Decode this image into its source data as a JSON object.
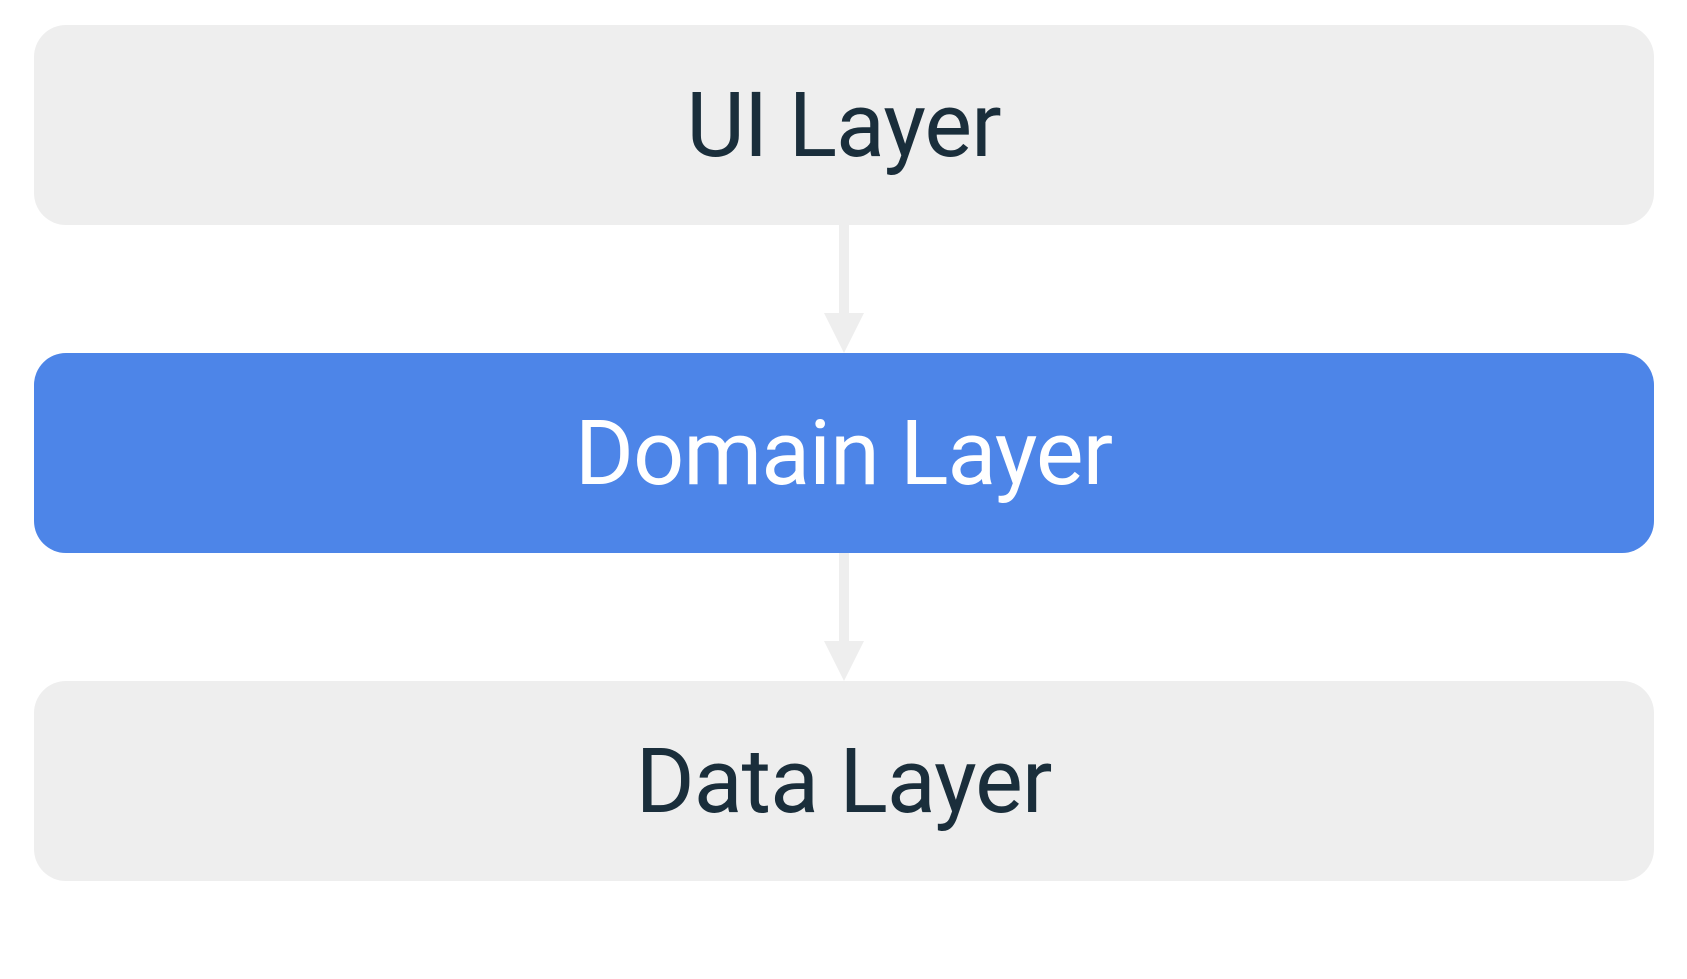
{
  "diagram": {
    "layers": [
      {
        "label": "UI Layer",
        "highlighted": false
      },
      {
        "label": "Domain Layer",
        "highlighted": true
      },
      {
        "label": "Data Layer",
        "highlighted": false
      }
    ],
    "colors": {
      "gray_bg": "#eeeeee",
      "blue_bg": "#4d85e8",
      "text_dark": "#1a2e3b",
      "text_light": "#ffffff",
      "arrow": "#eeeeee"
    }
  }
}
